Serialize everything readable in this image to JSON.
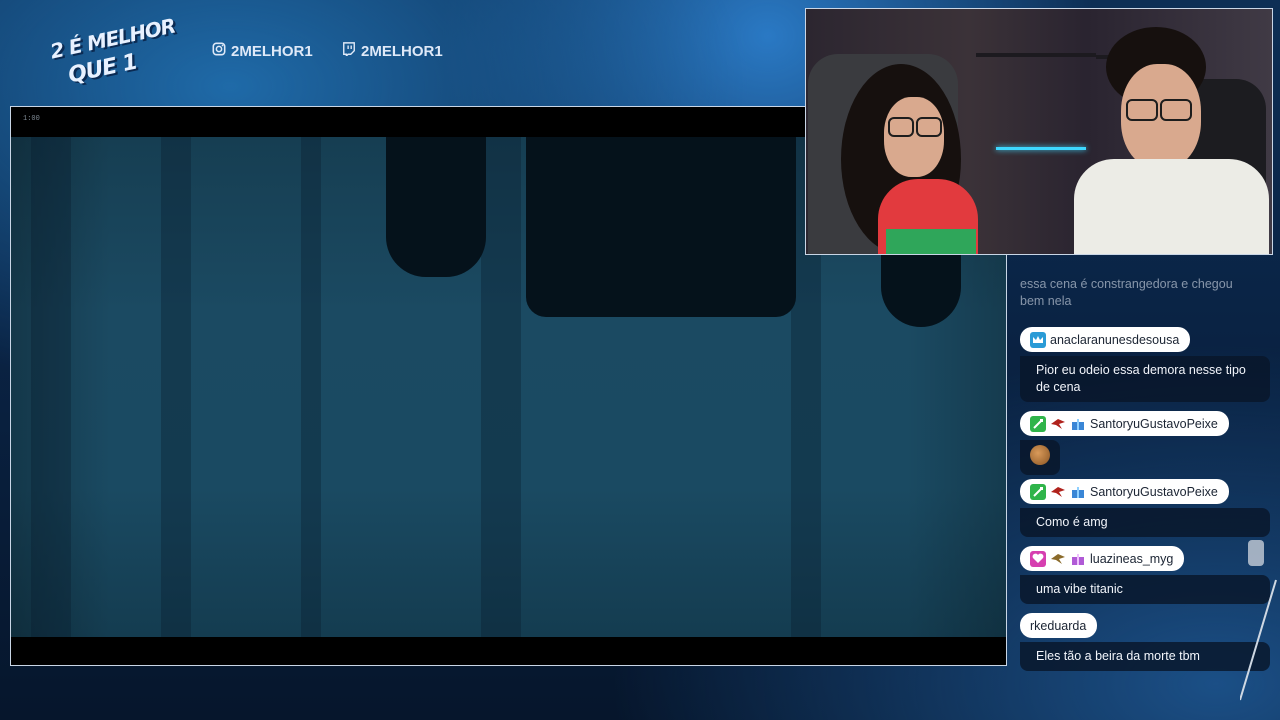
{
  "brand": {
    "logo_line1": "2 É MELHOR",
    "logo_line2": "QUE 1"
  },
  "social": {
    "instagram_handle": "2MELHOR1",
    "twitch_handle": "2MELHOR1",
    "instagram_icon": "instagram-icon",
    "twitch_icon": "twitch-icon"
  },
  "video": {
    "timestamp": "1:00"
  },
  "chat": {
    "faded_message": "essa cena é constrangedora e chegou bem nela",
    "messages": [
      {
        "username": "anaclaranunesdesousa",
        "badges": [
          "crown-badge-icon"
        ],
        "text": "Pior eu odeio essa demora nesse tipo de cena"
      },
      {
        "username": "SantoryuGustavoPeixe",
        "badges": [
          "sword-badge-icon",
          "bird-badge-icon",
          "gift-badge-icon"
        ],
        "text": "",
        "emote": "emote-icon"
      },
      {
        "username": "SantoryuGustavoPeixe",
        "badges": [
          "sword-badge-icon",
          "bird-badge-icon",
          "gift-badge-icon"
        ],
        "text": "Como é amg"
      },
      {
        "username": "luazineas_myg",
        "badges": [
          "heart-badge-icon",
          "bird-badge-icon",
          "gift-badge-icon"
        ],
        "text": "uma vibe titanic"
      },
      {
        "username": "rkeduarda",
        "badges": [],
        "text": "Eles tão a beira da morte tbm"
      }
    ]
  },
  "colors": {
    "accent": "#1f6aa8",
    "pill_bg": "#ffffff",
    "chat_bg": "#08162a"
  }
}
